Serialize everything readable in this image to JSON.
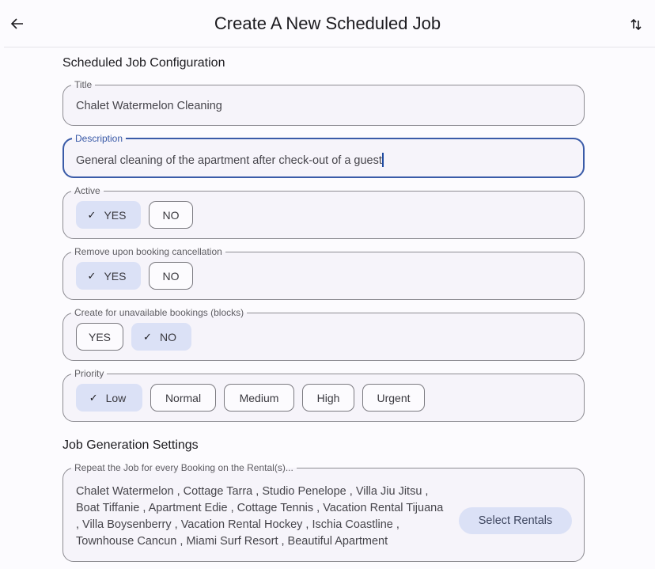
{
  "appbar": {
    "title": "Create A New Scheduled Job",
    "back_icon": "arrow-left-icon",
    "sort_icon": "swap-vertical-icon"
  },
  "sections": {
    "configuration": "Scheduled Job Configuration",
    "generation": "Job Generation Settings"
  },
  "title_field": {
    "label": "Title",
    "value": "Chalet Watermelon Cleaning"
  },
  "description_field": {
    "label": "Description",
    "value": "General cleaning of the apartment after check-out of a guest",
    "focused": true
  },
  "active": {
    "label": "Active",
    "options": [
      "YES",
      "NO"
    ],
    "selected": "YES"
  },
  "remove_on_cancel": {
    "label": "Remove upon booking cancellation",
    "options": [
      "YES",
      "NO"
    ],
    "selected": "YES"
  },
  "unavailable_bookings": {
    "label": "Create for unavailable bookings (blocks)",
    "options": [
      "YES",
      "NO"
    ],
    "selected": "NO"
  },
  "priority": {
    "label": "Priority",
    "options": [
      "Low",
      "Normal",
      "Medium",
      "High",
      "Urgent"
    ],
    "selected": "Low"
  },
  "rentals": {
    "label": "Repeat the Job for every Booking on the Rental(s)...",
    "value": "Chalet Watermelon , Cottage Tarra , Studio Penelope , Villa Jiu Jitsu , Boat Tiffanie , Apartment Edie , Cottage Tennis , Vacation Rental Tijuana , Villa Boysenberry , Vacation Rental Hockey , Ischia Coastline , Townhouse Cancun , Miami Surf Resort , Beautiful Apartment",
    "button_label": "Select Rentals"
  },
  "colors": {
    "accent": "#3a5ba8",
    "chip_selected_bg": "#dbe1f6",
    "field_bg": "#f6f4fa",
    "page_bg": "#fcfbfe"
  },
  "check_glyph": "✓"
}
